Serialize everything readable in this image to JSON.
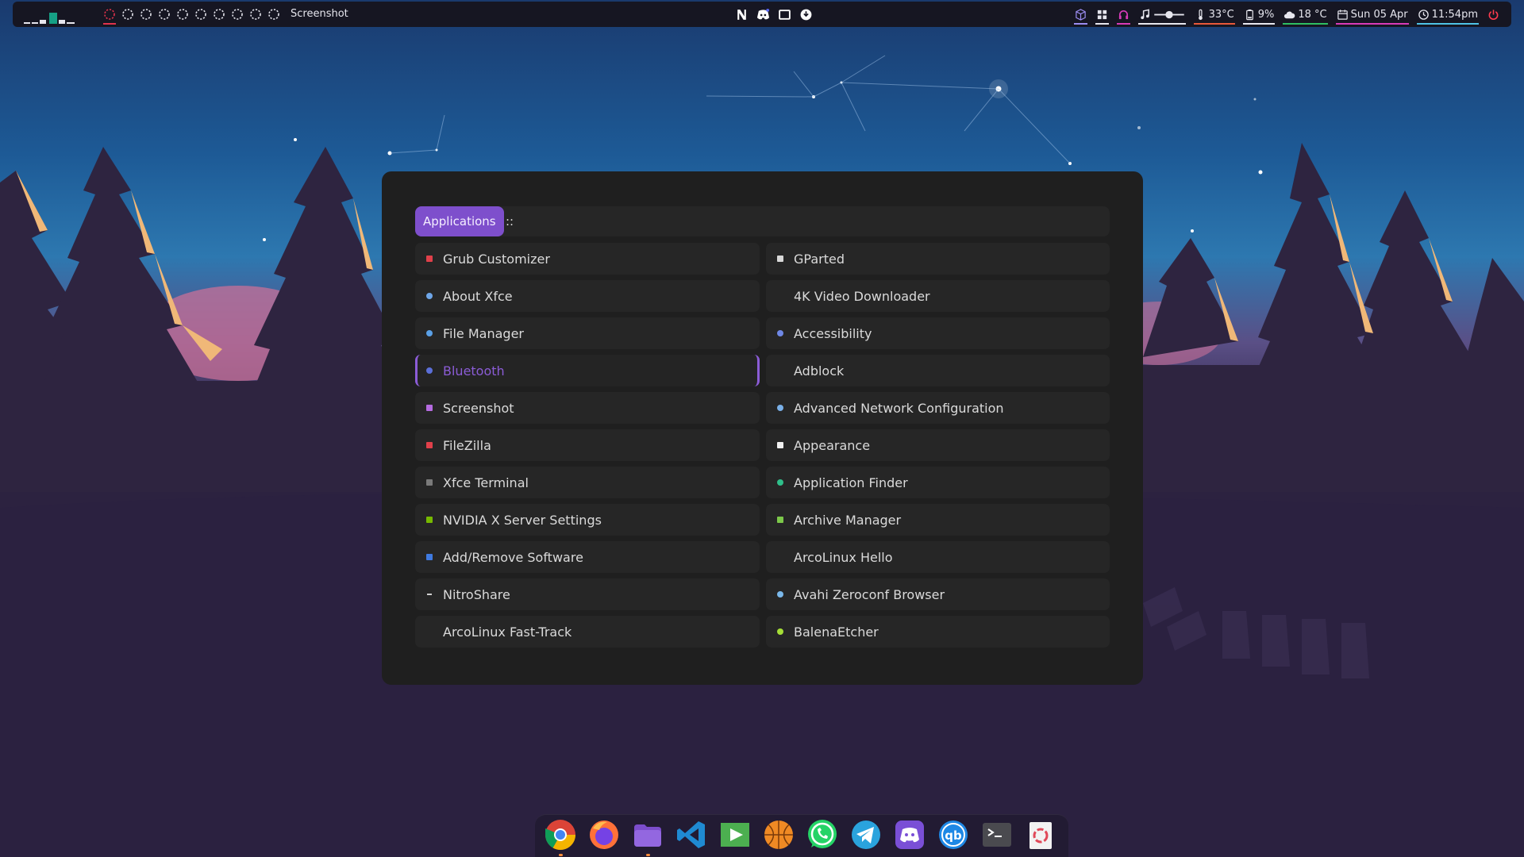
{
  "topbar": {
    "window_title": "Screenshot",
    "workspace_count": 10,
    "active_workspace": 1,
    "tray_center_icons": [
      "notion-icon",
      "discord-icon",
      "window-icon",
      "update-icon"
    ],
    "temperature": "33°C",
    "battery": "9%",
    "weather": "18 °C",
    "date": "Sun 05 Apr",
    "time": "11:54pm",
    "colors": {
      "accent": "#7e4fcc",
      "workspace_active": "#e0334c",
      "temp_underline": "#e8583a",
      "battery_underline": "#e6e6ee",
      "weather_underline": "#2fbf63",
      "date_underline": "#d83bb8",
      "time_underline": "#4ec3e6",
      "power": "#ff3b4e"
    }
  },
  "launcher": {
    "mode_label": "Applications",
    "prompt": "::",
    "selected_entry": "Bluetooth",
    "left_column": [
      {
        "label": "Grub Customizer",
        "icon": "grub-customizer-icon",
        "color": "#e0404a",
        "shape": "square"
      },
      {
        "label": "About Xfce",
        "icon": "xfce-icon",
        "color": "#6ea6e8",
        "shape": "circle"
      },
      {
        "label": "File Manager",
        "icon": "file-manager-icon",
        "color": "#5aa0e6",
        "shape": "circle"
      },
      {
        "label": "Bluetooth",
        "icon": "bluetooth-icon",
        "color": "#5b6fd8",
        "shape": "circle"
      },
      {
        "label": "Screenshot",
        "icon": "screenshot-icon",
        "color": "#b56be0",
        "shape": "square"
      },
      {
        "label": "FileZilla",
        "icon": "filezilla-icon",
        "color": "#e0404a",
        "shape": "square"
      },
      {
        "label": "Xfce Terminal",
        "icon": "terminal-icon",
        "color": "#7a7a7a",
        "shape": "square"
      },
      {
        "label": "NVIDIA X Server Settings",
        "icon": "nvidia-icon",
        "color": "#76b900",
        "shape": "square"
      },
      {
        "label": "Add/Remove Software",
        "icon": "software-icon",
        "color": "#3f7ae0",
        "shape": "square"
      },
      {
        "label": "NitroShare",
        "icon": "nitroshare-icon",
        "color": "#d0d0d0",
        "shape": "dash"
      },
      {
        "label": "ArcoLinux Fast-Track",
        "icon": "",
        "color": "",
        "shape": "none"
      }
    ],
    "right_column": [
      {
        "label": "GParted",
        "icon": "gparted-icon",
        "color": "#d8d8d8",
        "shape": "square"
      },
      {
        "label": "4K Video Downloader",
        "icon": "",
        "color": "",
        "shape": "none"
      },
      {
        "label": "Accessibility",
        "icon": "accessibility-icon",
        "color": "#6f88e6",
        "shape": "circle"
      },
      {
        "label": "Adblock",
        "icon": "",
        "color": "",
        "shape": "none"
      },
      {
        "label": "Advanced Network Configuration",
        "icon": "network-icon",
        "color": "#7ab0e8",
        "shape": "circle"
      },
      {
        "label": "Appearance",
        "icon": "appearance-icon",
        "color": "#f0f0f0",
        "shape": "square"
      },
      {
        "label": "Application Finder",
        "icon": "app-finder-icon",
        "color": "#2fbf8a",
        "shape": "circle"
      },
      {
        "label": "Archive Manager",
        "icon": "archive-icon",
        "color": "#7cc84a",
        "shape": "square"
      },
      {
        "label": "ArcoLinux Hello",
        "icon": "",
        "color": "",
        "shape": "none"
      },
      {
        "label": "Avahi Zeroconf Browser",
        "icon": "avahi-icon",
        "color": "#7ab8ea",
        "shape": "circle"
      },
      {
        "label": "BalenaEtcher",
        "icon": "balenaetcher-icon",
        "color": "#a5de37",
        "shape": "circle"
      }
    ]
  },
  "dock": {
    "apps": [
      {
        "name": "chrome-icon",
        "running": true
      },
      {
        "name": "firefox-icon",
        "running": false
      },
      {
        "name": "files-icon",
        "running": true
      },
      {
        "name": "vscode-icon",
        "running": false
      },
      {
        "name": "media-player-icon",
        "running": false
      },
      {
        "name": "basketball-icon",
        "running": false
      },
      {
        "name": "whatsapp-icon",
        "running": false
      },
      {
        "name": "telegram-icon",
        "running": false
      },
      {
        "name": "discord-icon",
        "running": false
      },
      {
        "name": "qbittorrent-icon",
        "running": false
      },
      {
        "name": "terminal-icon",
        "running": false
      },
      {
        "name": "trash-icon",
        "running": false
      }
    ]
  }
}
